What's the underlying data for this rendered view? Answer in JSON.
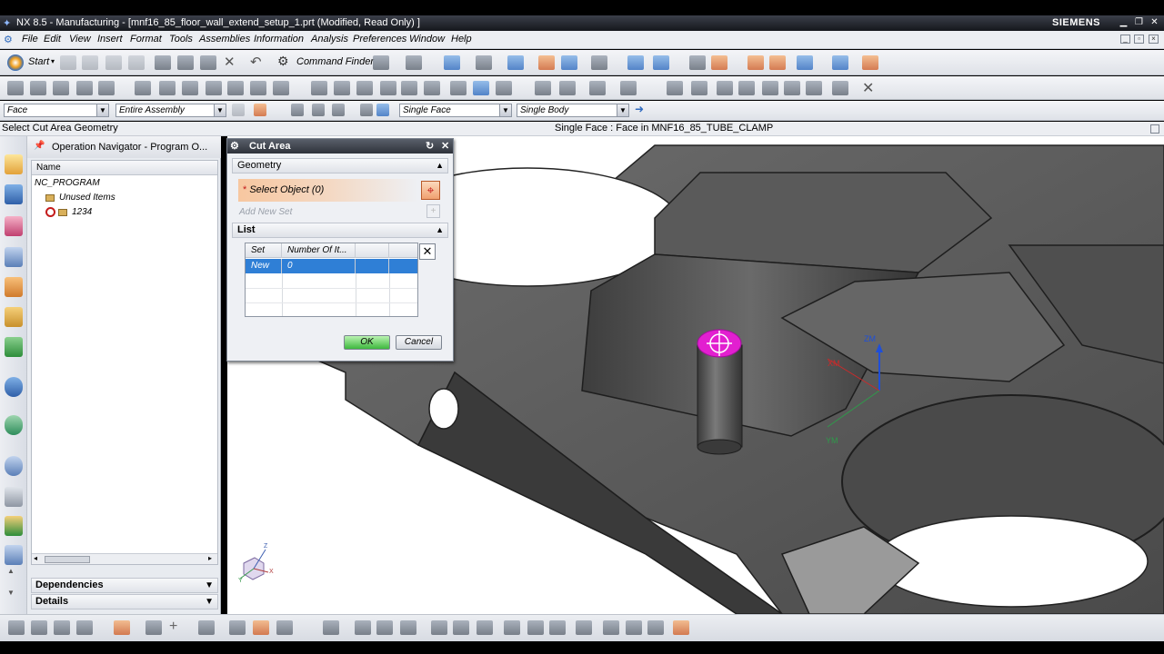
{
  "app": {
    "title": "NX 8.5 - Manufacturing - [mnf16_85_floor_wall_extend_setup_1.prt (Modified, Read Only) ]",
    "brand": "SIEMENS"
  },
  "menu": [
    "File",
    "Edit",
    "View",
    "Insert",
    "Format",
    "Tools",
    "Assemblies",
    "Information",
    "Analysis",
    "Preferences",
    "Window",
    "Help"
  ],
  "toolbar": {
    "start_label": "Start",
    "command_finder_label": "Command Finder"
  },
  "selection_bar": {
    "type_filter": "Face",
    "scope": "Entire Assembly",
    "face_rule": "Single Face",
    "body_rule": "Single Body"
  },
  "status": {
    "prompt": "Select Cut Area Geometry",
    "selection_info": "Single Face : Face in MNF16_85_TUBE_CLAMP"
  },
  "navigator": {
    "title": "Operation Navigator - Program O...",
    "column_name": "Name",
    "rows": [
      {
        "label": "NC_PROGRAM"
      },
      {
        "label": "Unused Items"
      },
      {
        "label": "1234"
      }
    ],
    "sections": [
      "Dependencies",
      "Details"
    ]
  },
  "dialog": {
    "title": "Cut Area",
    "geometry_section": "Geometry",
    "select_object": "Select Object (0)",
    "add_new_set": "Add New Set",
    "list_section": "List",
    "columns": [
      "Set",
      "Number Of It..."
    ],
    "rows": [
      {
        "set": "New",
        "count": "0"
      }
    ],
    "ok": "OK",
    "cancel": "Cancel"
  },
  "viewport": {
    "wcs_labels": [
      "ZM",
      "YM",
      "XM"
    ],
    "triad_labels": [
      "Z",
      "X",
      "Y"
    ]
  },
  "colors": {
    "titlebar": "#1b1d22",
    "menubar": "#eceef2",
    "select_highlight": "#e21fd0",
    "selected_row": "#2f7fd6",
    "wcs_z": "#1f4fd8",
    "wcs_y": "#2e9b4a",
    "wcs_x": "#cc2a2a"
  }
}
